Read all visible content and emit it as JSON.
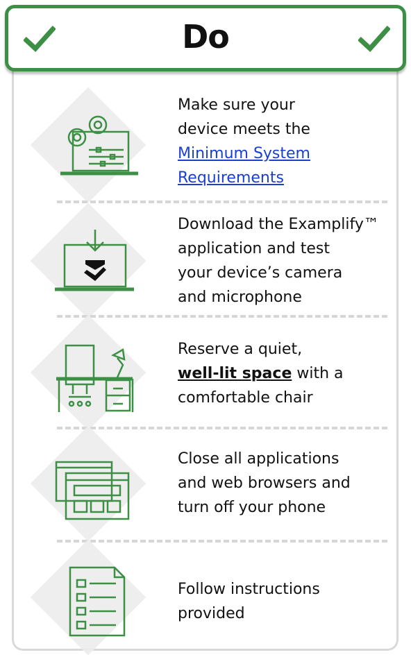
{
  "header": {
    "title": "Do"
  },
  "items": [
    {
      "line1": "Make sure your",
      "line2": "device meets the",
      "link1": "Minimum System",
      "link2": "Requirements"
    },
    {
      "line1": "Download the Examplify™",
      "line2": "application and test",
      "line3": "your device’s camera",
      "line4": "and microphone"
    },
    {
      "line1": "Reserve a quiet,",
      "emph": "well-lit space",
      "line2_rest": " with a",
      "line3": "comfortable chair"
    },
    {
      "line1": "Close all applications",
      "line2": "and web browsers and",
      "line3": "turn off your phone"
    },
    {
      "line1": "Follow instructions",
      "line2": "provided"
    }
  ],
  "colors": {
    "accent": "#3c8f44",
    "link": "#1a3fcf",
    "divider": "#d6d6d6",
    "icon_bg": "#ececec"
  }
}
